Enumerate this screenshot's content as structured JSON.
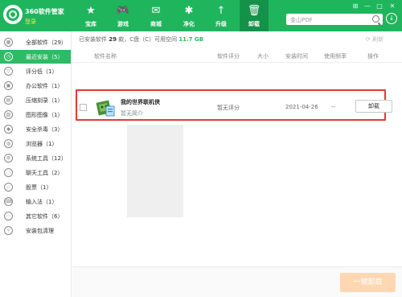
{
  "app": {
    "title": "360软件管家",
    "login_label": "登录"
  },
  "nav": [
    {
      "label": "宝库",
      "icon": "star-icon",
      "glyph": "★"
    },
    {
      "label": "游戏",
      "icon": "gamepad-icon",
      "glyph": "🎮"
    },
    {
      "label": "商城",
      "icon": "mail-bag-icon",
      "glyph": "✉"
    },
    {
      "label": "净化",
      "icon": "compass-icon",
      "glyph": "✱"
    },
    {
      "label": "升级",
      "icon": "upload-arrow-icon",
      "glyph": "↑"
    },
    {
      "label": "卸载",
      "icon": "trash-icon",
      "glyph": "🗑"
    }
  ],
  "window_controls": [
    "⊞",
    "—",
    "□",
    "✕"
  ],
  "search": {
    "placeholder": "金山PDF"
  },
  "sidebar": {
    "items": [
      {
        "label": "全部软件（29）",
        "icon": "grid-icon",
        "glyph": "▦"
      },
      {
        "label": "最近安装（5）",
        "icon": "clock-icon",
        "glyph": "◷"
      },
      {
        "label": "评分低（1）",
        "icon": "thumbs-down-icon",
        "glyph": "▽"
      },
      {
        "label": "办公软件（1）",
        "icon": "briefcase-icon",
        "glyph": "▣"
      },
      {
        "label": "压缩刻录（1）",
        "icon": "archive-icon",
        "glyph": "▤"
      },
      {
        "label": "图形图像（1）",
        "icon": "image-icon",
        "glyph": "▧"
      },
      {
        "label": "安全杀毒（3）",
        "icon": "shield-icon",
        "glyph": "◆"
      },
      {
        "label": "浏览器（1）",
        "icon": "globe-icon",
        "glyph": "◍"
      },
      {
        "label": "系统工具（12）",
        "icon": "tools-icon",
        "glyph": "⚙"
      },
      {
        "label": "聊天工具（2）",
        "icon": "chat-icon",
        "glyph": "◌"
      },
      {
        "label": "股票（1）",
        "icon": "star-outline-icon",
        "glyph": "☆"
      },
      {
        "label": "输入法（1）",
        "icon": "keyboard-icon",
        "glyph": "⌨"
      },
      {
        "label": "其它软件（6）",
        "icon": "more-icon",
        "glyph": "⋯"
      },
      {
        "label": "安装包清理",
        "icon": "broom-icon",
        "glyph": "✧"
      }
    ]
  },
  "stats": {
    "prefix": "已安装软件",
    "count": "29",
    "middle": "款，C盘（C）可用空间",
    "free_space": "11.7 GB"
  },
  "refresh_label": "刷新",
  "columns": [
    "软件名称",
    "软件评分",
    "大小",
    "安装时间",
    "使用频率",
    "操作"
  ],
  "rows": [
    {
      "name": "我的世界联机侠",
      "description": "暂无简介",
      "rating": "暂无评分",
      "size": "",
      "install_date": "2021-04-26",
      "frequency": "--",
      "action": "卸载"
    }
  ],
  "bulk_uninstall_label": "一键卸载",
  "colors": {
    "header_green": "#1fb55d",
    "active_nav": "#15924a",
    "sidebar_active": "#2fba66",
    "highlight_red": "#e53935",
    "bulk_button": "#ffd8b3"
  }
}
